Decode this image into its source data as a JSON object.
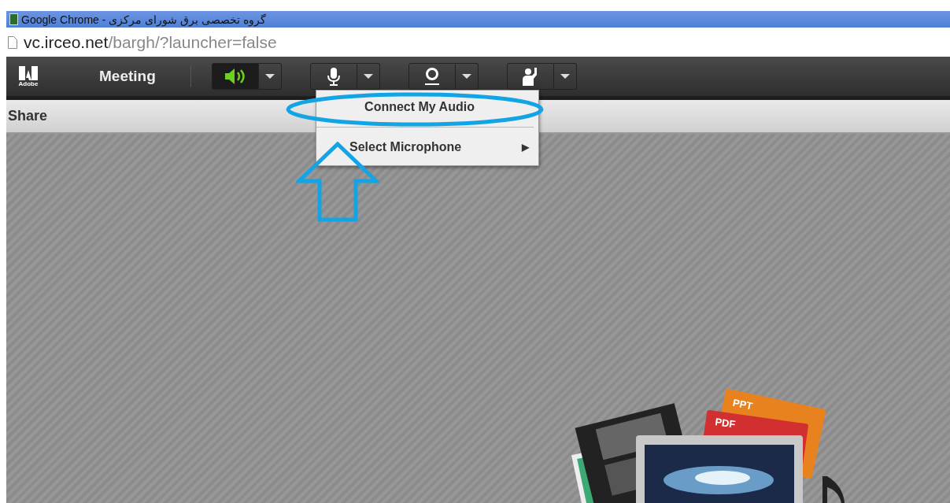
{
  "window": {
    "title": "گروه تخصصی برق شورای مرکزی - Google Chrome"
  },
  "address_bar": {
    "domain": "vc.irceo.net",
    "path": "/bargh/?launcher=false"
  },
  "toolbar": {
    "logo_text": "Adobe",
    "menu_label": "Meeting",
    "buttons": [
      {
        "kind": "speaker",
        "on": true
      },
      {
        "kind": "microphone",
        "on": false
      },
      {
        "kind": "camera",
        "on": false
      },
      {
        "kind": "raise-hand",
        "on": false
      }
    ]
  },
  "pod": {
    "title": "Share",
    "media_labels": [
      "PPT",
      "PDF"
    ]
  },
  "dropdown_menu": {
    "items": [
      {
        "label": "Connect My Audio"
      },
      {
        "label": "Select Microphone",
        "arrow": "▶"
      }
    ]
  }
}
